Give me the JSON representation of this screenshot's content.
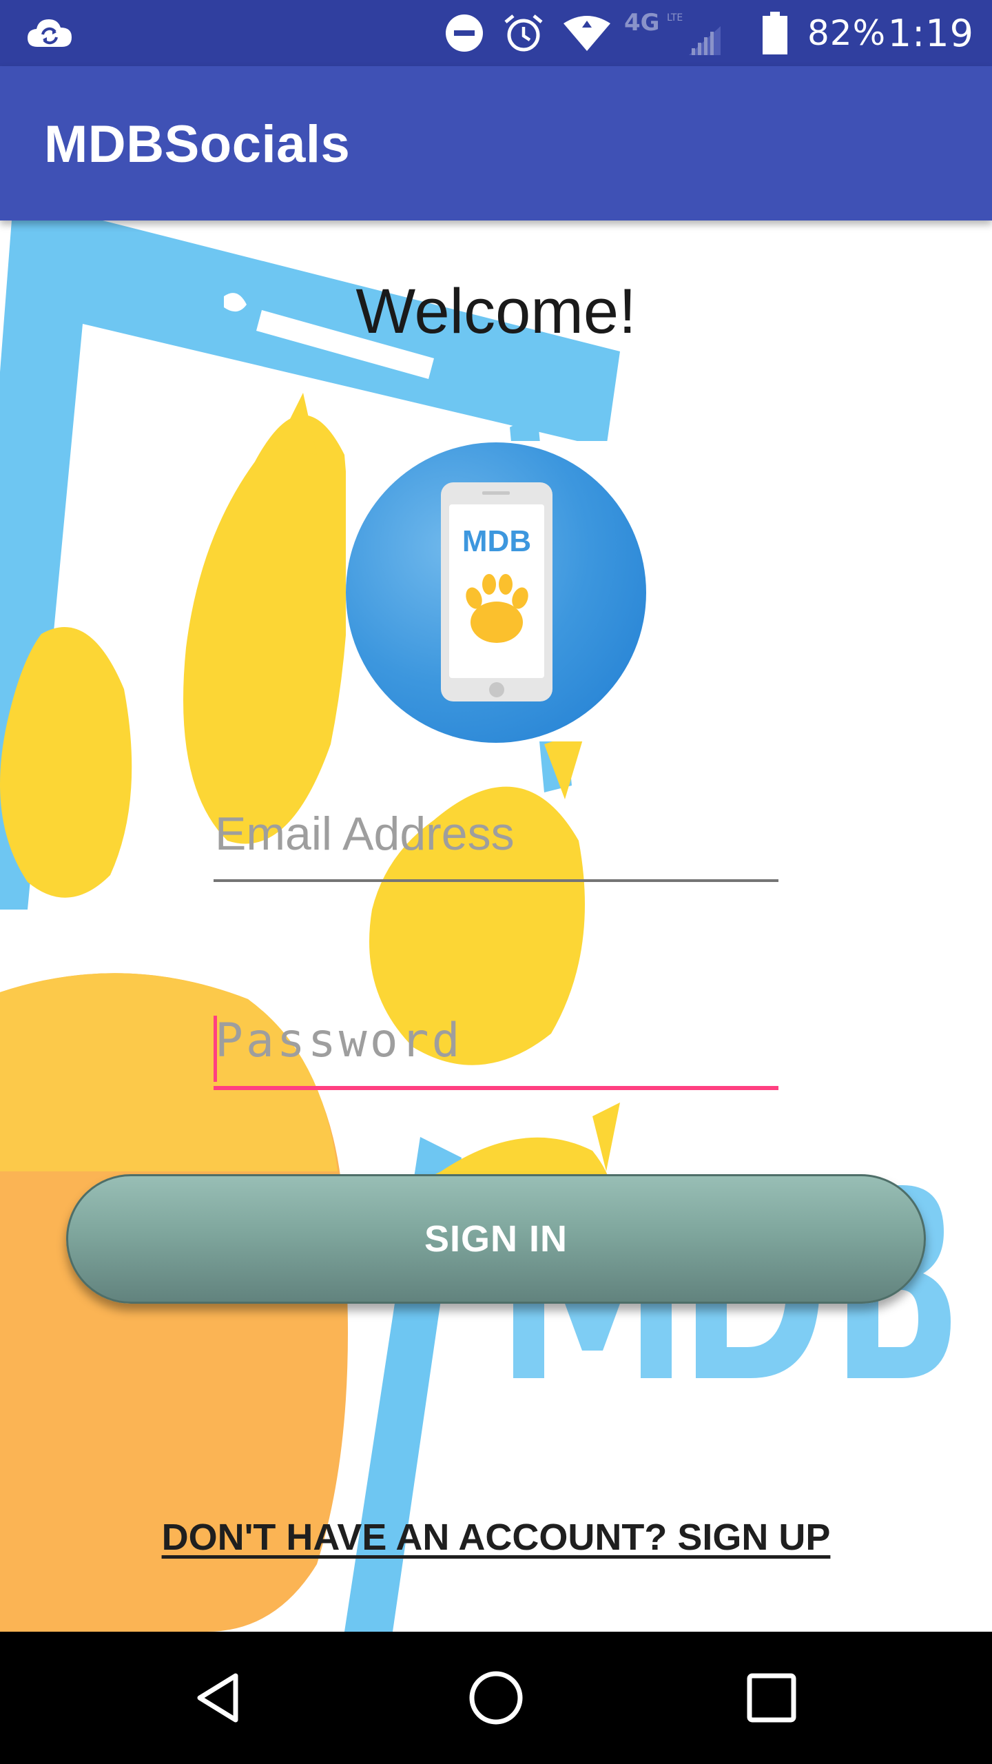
{
  "status_bar": {
    "battery_text": "82%",
    "time": "1:19",
    "network_label": "4G",
    "icons": [
      "sync-cloud-icon",
      "do-not-disturb-icon",
      "alarm-icon",
      "wifi-icon",
      "lte-signal-icon",
      "battery-icon"
    ]
  },
  "app_bar": {
    "title": "MDBSocials"
  },
  "main": {
    "welcome": "Welcome!",
    "logo": {
      "text": "MDB",
      "icon": "phone-paw-logo"
    },
    "email_field": {
      "placeholder": "Email Address",
      "value": ""
    },
    "password_field": {
      "placeholder": "Password",
      "value": ""
    },
    "signin_label": "SIGN IN",
    "signup_label": "DON'T HAVE AN ACCOUNT? SIGN UP",
    "background_watermark": "MDB"
  },
  "nav_bar": {
    "icons": [
      "back-icon",
      "home-icon",
      "recents-icon"
    ]
  },
  "colors": {
    "status_bar": "#303f9f",
    "app_bar": "#3f51b5",
    "accent": "#ff4081",
    "button": "#7fa69d",
    "paw_yellow": "#fcd635",
    "phone_blue": "#6ec6f2"
  }
}
